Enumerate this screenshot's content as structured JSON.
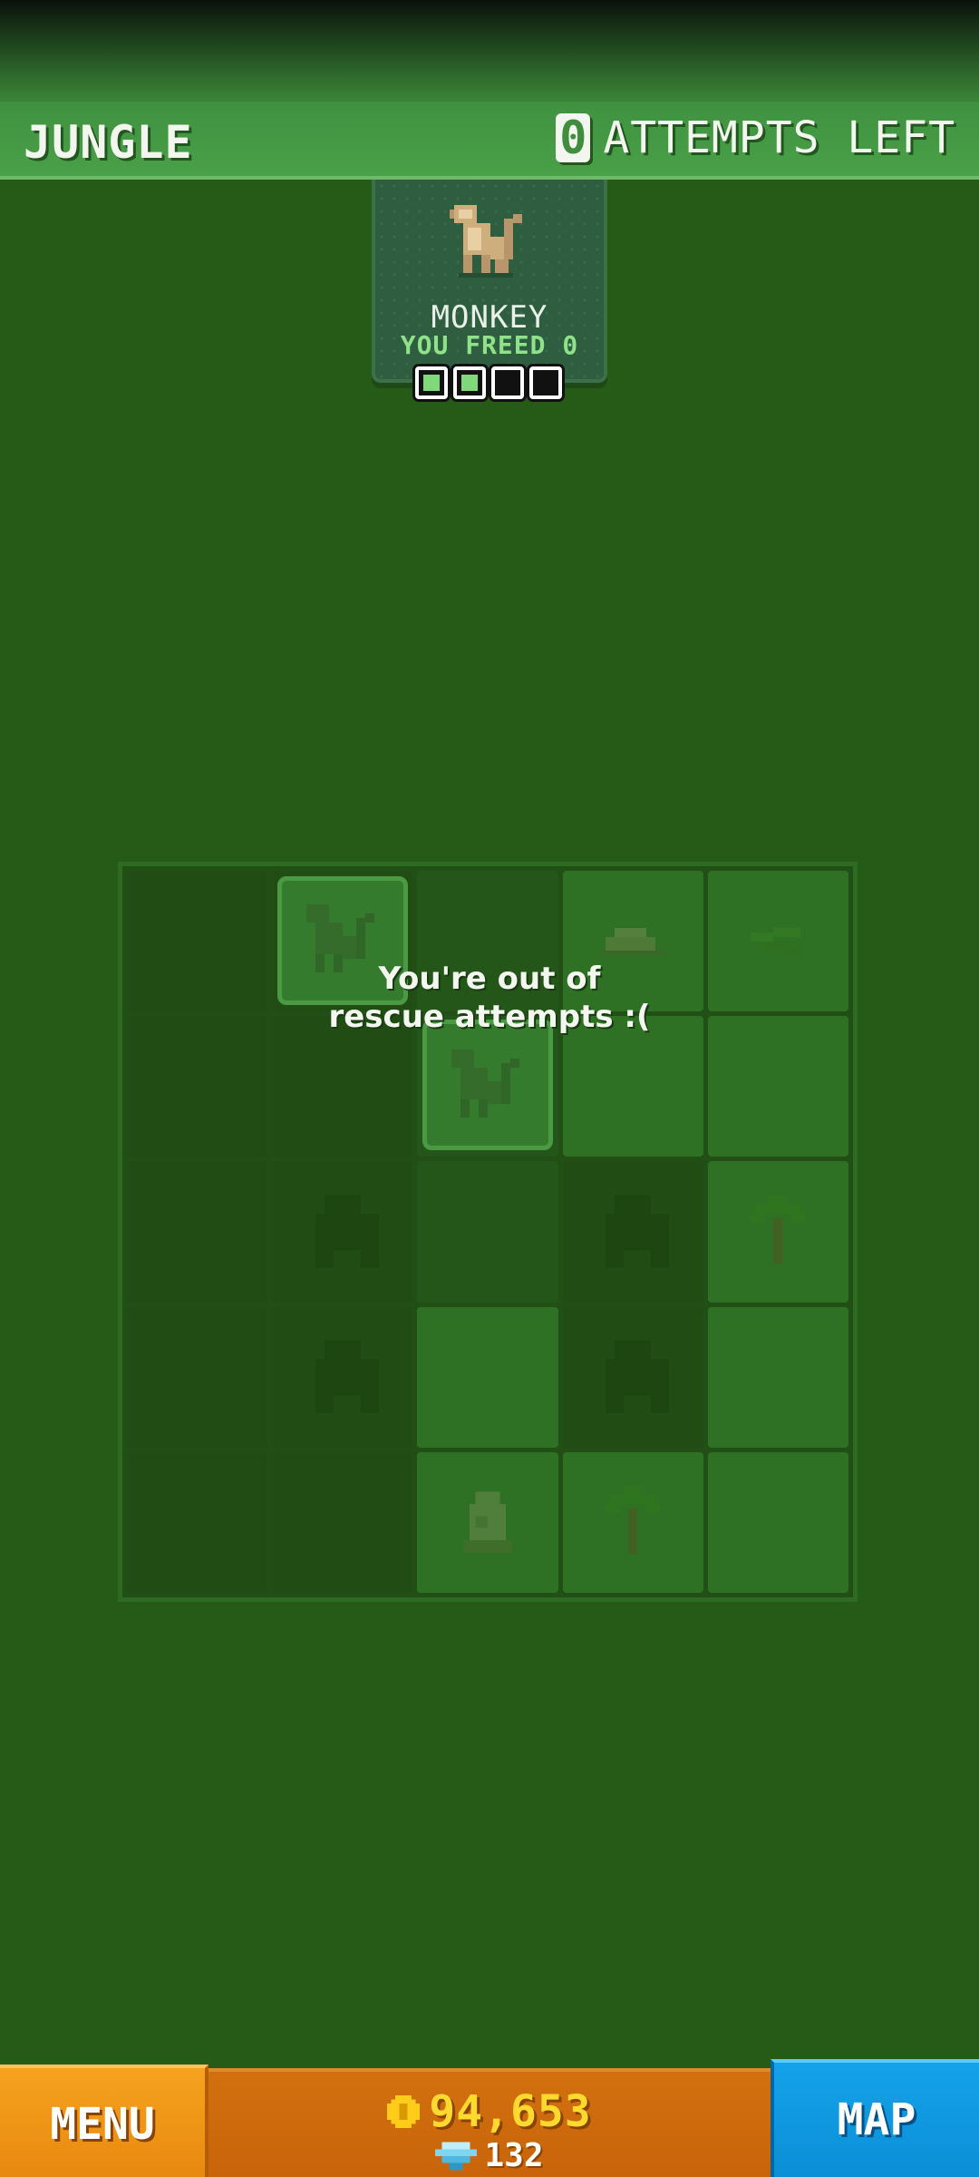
{
  "header": {
    "zone_title": "JUNGLE",
    "attempts_count": "0",
    "attempts_label": "ATTEMPTS LEFT"
  },
  "animal_card": {
    "name": "MONKEY",
    "status": "YOU FREED",
    "freed_count": "0",
    "progress": {
      "found": 2,
      "total": 4
    }
  },
  "board": {
    "message_line1": "You're out of",
    "message_line2": "rescue attempts :(",
    "cells": [
      [
        "dark",
        "dark",
        "mid",
        "lighter",
        "lighter"
      ],
      [
        "dark",
        "dark",
        "mid",
        "lighter",
        "lighter"
      ],
      [
        "dark",
        "dark",
        "mid",
        "dark",
        "lighter"
      ],
      [
        "dark",
        "dark",
        "lighter",
        "dark",
        "lighter"
      ],
      [
        "dark",
        "dark",
        "lighter",
        "lighter",
        "lighter"
      ]
    ],
    "icons": {
      "monkey": "monkey-icon",
      "rock": "rock-icon",
      "palm": "palm-tree-icon",
      "gorilla": "gorilla-silhouette-icon",
      "egg": "egg-icon",
      "leaves": "leaves-icon"
    }
  },
  "footer": {
    "menu_label": "MENU",
    "coins": "94,653",
    "gems": "132",
    "map_label": "MAP"
  },
  "colors": {
    "background": "#255a17",
    "top_bar": "#4aa048",
    "menu_button": "#f6a21f",
    "currency_panel": "#d2700f",
    "map_button": "#14a2ea",
    "coin_text": "#ffd92e",
    "freed_text": "#8fe28a"
  }
}
